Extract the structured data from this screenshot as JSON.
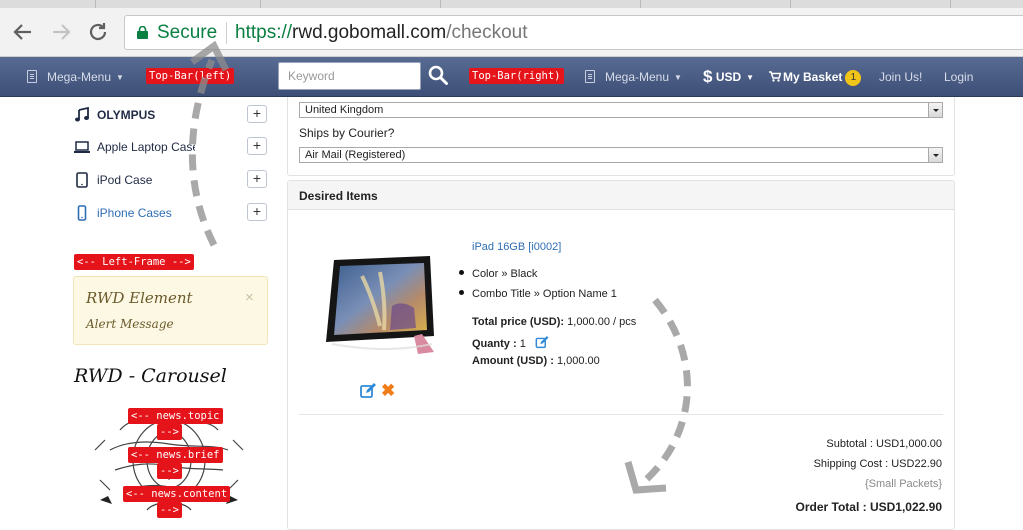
{
  "browser": {
    "secure_label": "Secure",
    "url_scheme": "https://",
    "url_host": "rwd.gobomall.com",
    "url_path": "/checkout",
    "secure_color": "#0b8043"
  },
  "topbar": {
    "mega_menu_left": "Mega-Menu",
    "tag_left": "Top-Bar(left)",
    "search_placeholder": "Keyword",
    "tag_right": "Top-Bar(right)",
    "mega_menu_right": "Mega-Menu",
    "currency": "USD",
    "currency_symbol": "$",
    "basket_label": "My Basket",
    "basket_count": "1",
    "join_label": "Join Us!",
    "login_label": "Login",
    "bar_color": "#4a5d85"
  },
  "sidebar": {
    "categories": [
      {
        "label": "OLYMPUS",
        "icon": "music-note-icon"
      },
      {
        "label": "Apple Laptop Case",
        "icon": "laptop-icon"
      },
      {
        "label": "iPod Case",
        "icon": "tablet-icon"
      },
      {
        "label": "iPhone Cases",
        "icon": "phone-icon"
      }
    ],
    "expand_symbol": "+",
    "frame_tag": "<-- Left-Frame -->",
    "alert_title": "RWD Element",
    "alert_message": "Alert Message",
    "alert_close": "×",
    "carousel_title": "RWD - Carousel",
    "carousel_tags": [
      "<-- news.topic",
      "-->",
      "<-- news.brief",
      "-->",
      "<-- news.content",
      "-->"
    ]
  },
  "shipping": {
    "country": "United Kingdom",
    "courier_label": "Ships by Courier?",
    "courier": "Air Mail (Registered)"
  },
  "items": {
    "title": "Desired Items",
    "product_link": "iPad 16GB [i0002]",
    "attributes": [
      "Color » Black",
      "Combo Title » Option Name 1"
    ],
    "total_price_label": "Total price (USD):",
    "total_price_value": "1,000.00  / pcs",
    "quantity_label": "Quanty :",
    "quantity_value": "1",
    "amount_label": "Amount (USD) :",
    "amount_value": "1,000.00",
    "delete_symbol": "✖"
  },
  "totals": {
    "subtotal": "Subtotal : USD1,000.00",
    "shipping": "Shipping Cost : USD22.90",
    "packets": "{Small Packets}",
    "order_total": "Order Total : USD1,022.90"
  }
}
